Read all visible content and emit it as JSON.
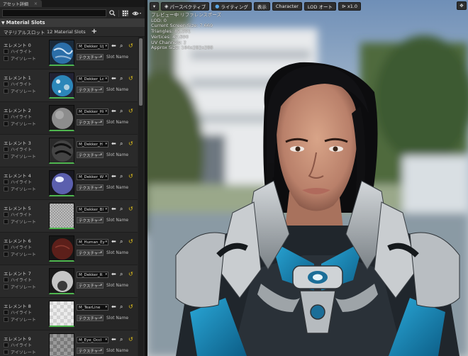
{
  "details_panel": {
    "tab_title": "アセット詳細",
    "search_placeholder": "",
    "category": "Material Slots",
    "slots_label": "マテリアルスロット",
    "slots_count": "12 Material Slots",
    "add_label": "+",
    "highlight_label": "ハイライト",
    "isolate_label": "アイソレート",
    "texture_label": "テクスチャー",
    "slot_name_label": "Slot Name",
    "elements": [
      {
        "name": "エレメント 0",
        "material": "M_Dekker_Uj",
        "thumb": "blue-marble"
      },
      {
        "name": "エレメント 1",
        "material": "M_Dekker_Lc",
        "thumb": "blue-speckle"
      },
      {
        "name": "エレメント 2",
        "material": "M_Dekker_Hi",
        "thumb": "grey-skin"
      },
      {
        "name": "エレメント 3",
        "material": "M_Dekker_H",
        "thumb": "dark-hair"
      },
      {
        "name": "エレメント 4",
        "material": "M_Dekker_W",
        "thumb": "chrome-blue"
      },
      {
        "name": "エレメント 5",
        "material": "M_Dekker_Bl",
        "thumb": "checker-grey"
      },
      {
        "name": "エレメント 6",
        "material": "M_Human_Ey",
        "thumb": "red-eye"
      },
      {
        "name": "エレメント 7",
        "material": "M_Dekker_R",
        "thumb": "white-eye"
      },
      {
        "name": "エレメント 8",
        "material": "M_TearLine",
        "thumb": "checker-light"
      },
      {
        "name": "エレメント 9",
        "material": "M_Eye_Occl",
        "thumb": "checker-dark"
      }
    ]
  },
  "viewport": {
    "toolbar": {
      "perspective": "パースペクティブ",
      "lighting": "ライティング",
      "show": "表示",
      "character": "Character",
      "lod": "LOD オート",
      "speed": "x1.0"
    },
    "stats": [
      "プレビュー中 リファレンスポーズ",
      "LOD: 0",
      "Current Screen Size: 7.669",
      "Triangles: 82,291",
      "Vertices: 47,690",
      "UV Channels: 2",
      "Approx Size: 184x282x288"
    ]
  },
  "colors": {
    "panel_bg": "#242424",
    "accent_green": "#4fb64f",
    "reset_yellow": "#e3c21a",
    "suit_blue": "#1fa5d6"
  },
  "icons": {
    "search": "search-icon",
    "grid_view": "grid-view-icon",
    "eye": "eye-icon",
    "back_arrow": "use-selected-arrow-icon",
    "browse": "browse-icon",
    "reset": "reset-to-default-icon",
    "perspective": "perspective-icon",
    "lighting": "lighting-sphere-icon",
    "speed": "play-speed-icon",
    "camera_move": "camera-move-icon"
  }
}
